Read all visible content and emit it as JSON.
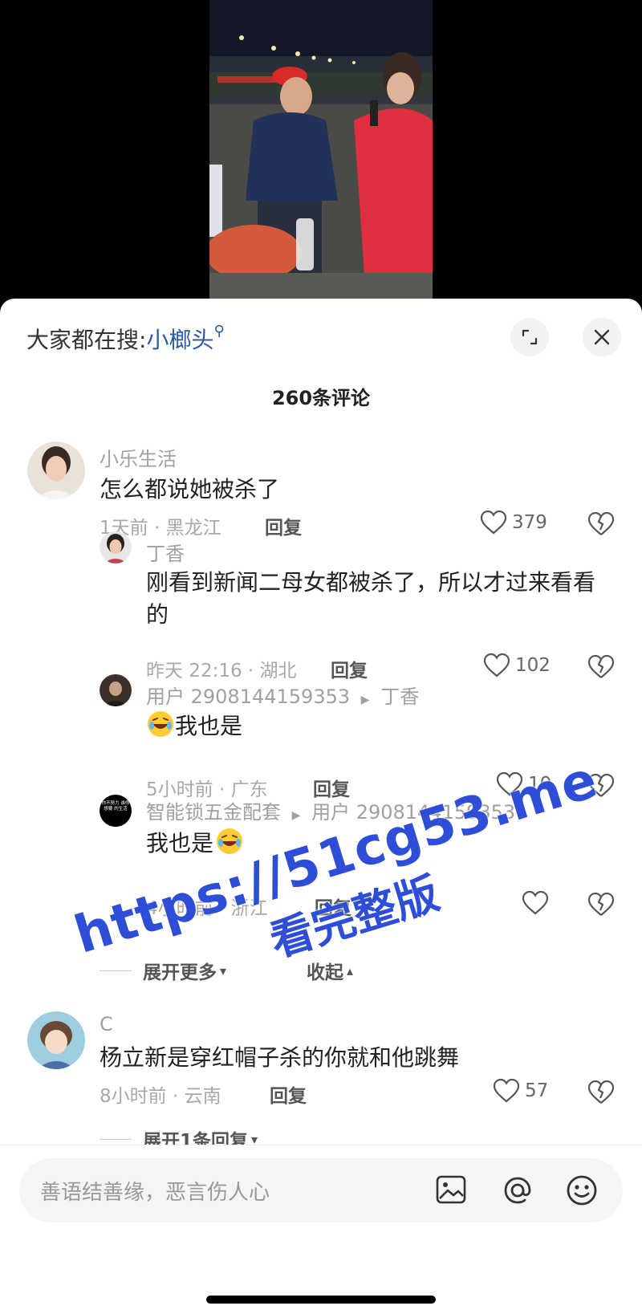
{
  "search": {
    "prefix": "大家都在搜:",
    "keyword": "小榔头"
  },
  "comment_count": "260条评论",
  "comments": [
    {
      "user": "小乐生活",
      "text": "怎么都说她被杀了",
      "meta": "1天前 · 黑龙江",
      "reply": "回复",
      "likes": "379"
    },
    {
      "user": "丁香",
      "text": "刚看到新闻二母女都被杀了，所以才过来看看的",
      "meta": "昨天 22:16 · 湖北",
      "reply": "回复",
      "likes": "102"
    },
    {
      "user": "用户 2908144159353",
      "reply_to": "丁香",
      "text": "我也是",
      "meta": "5小时前 · 广东",
      "reply": "回复",
      "likes": "10"
    },
    {
      "user": "智能锁五金配套",
      "reply_to": "用户 2908144159353",
      "text": "我也是",
      "meta": "4小时前 · 浙江",
      "reply": "回复",
      "likes": ""
    },
    {
      "user": "C",
      "text": "杨立新是穿红帽子杀的你就和他跳舞",
      "meta": "8小时前 · 云南",
      "reply": "回复",
      "likes": "57"
    }
  ],
  "expand_more": "展开更多",
  "collapse": "收起",
  "expand_one": "展开1条回复",
  "input_placeholder": "善语结善缘，恶言伤人心",
  "avatar3_text": "你不努力 谁你想要 的生活",
  "watermark": {
    "line1": "https://51cg53.me",
    "line2": "看完整版"
  },
  "colors": {
    "keyword": "#2c5aa0",
    "watermark": "#2f4ed8"
  }
}
